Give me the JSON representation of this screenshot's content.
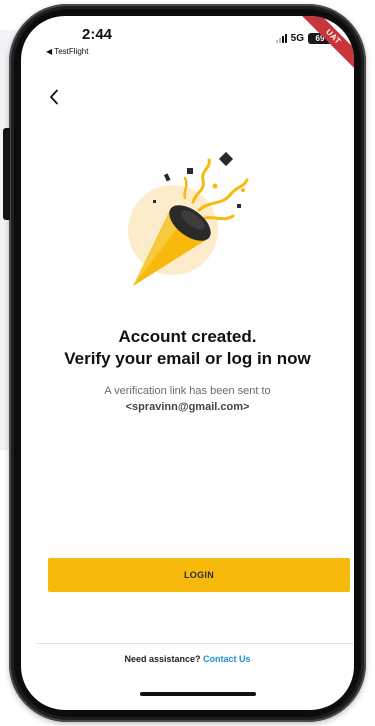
{
  "status_bar": {
    "time": "2:44",
    "back_app": "◀ TestFlight",
    "network": "5G",
    "battery": "69",
    "ribbon": "UAT"
  },
  "nav": {
    "back_icon": "chevron-left-icon"
  },
  "illustration": {
    "icon": "party-popper-icon",
    "colors": {
      "accent": "#f7b90b",
      "circle": "#fdeccc",
      "dark": "#2a2a2a"
    }
  },
  "content": {
    "title_line1": "Account created.",
    "title_line2": "Verify your email or log in now",
    "subtitle": "A verification link has been sent to",
    "email": "<spravinn@gmail.com>"
  },
  "actions": {
    "login_label": "LOGIN"
  },
  "footer": {
    "question": "Need assistance?",
    "contact_label": "Contact Us"
  },
  "colors": {
    "primary": "#f7b90b",
    "link": "#1f8fd8",
    "ribbon": "#c8353c"
  }
}
